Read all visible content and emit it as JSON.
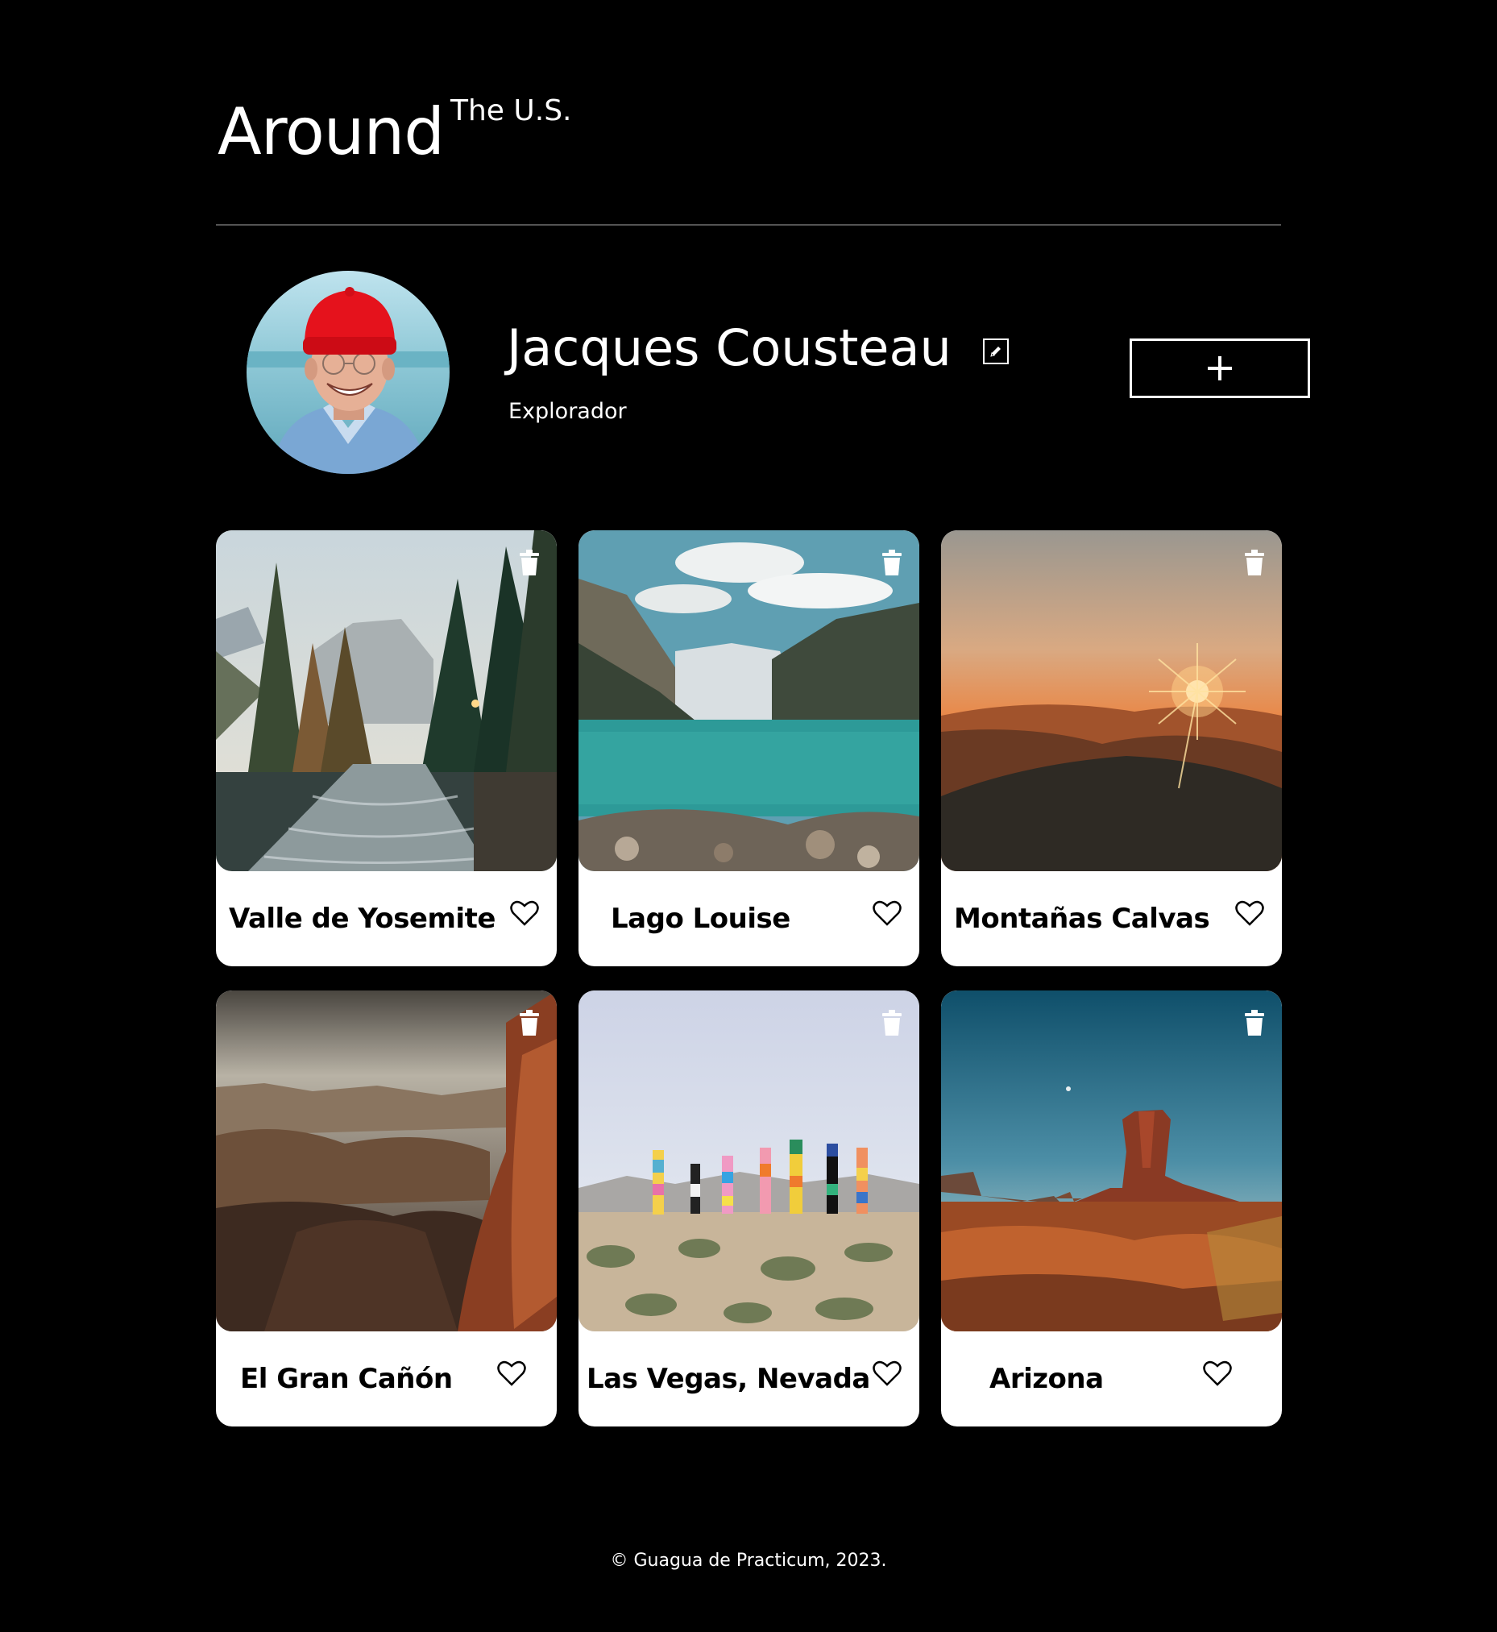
{
  "header": {
    "logo_main": "Around",
    "logo_sup": "The U.S."
  },
  "profile": {
    "name": "Jacques Cousteau",
    "job": "Explorador",
    "edit_icon": "pencil-icon",
    "add_icon": "plus-icon"
  },
  "cards": [
    {
      "title": "Valle de Yosemite"
    },
    {
      "title": "Lago Louise"
    },
    {
      "title": "Montañas Calvas"
    },
    {
      "title": "El Gran Cañón"
    },
    {
      "title": "Las Vegas, Nevada"
    },
    {
      "title": "Arizona"
    }
  ],
  "footer": {
    "text": "© Guagua de Practicum, 2023."
  },
  "colors": {
    "background": "#000000",
    "card": "#ffffff",
    "divider": "#545454"
  }
}
